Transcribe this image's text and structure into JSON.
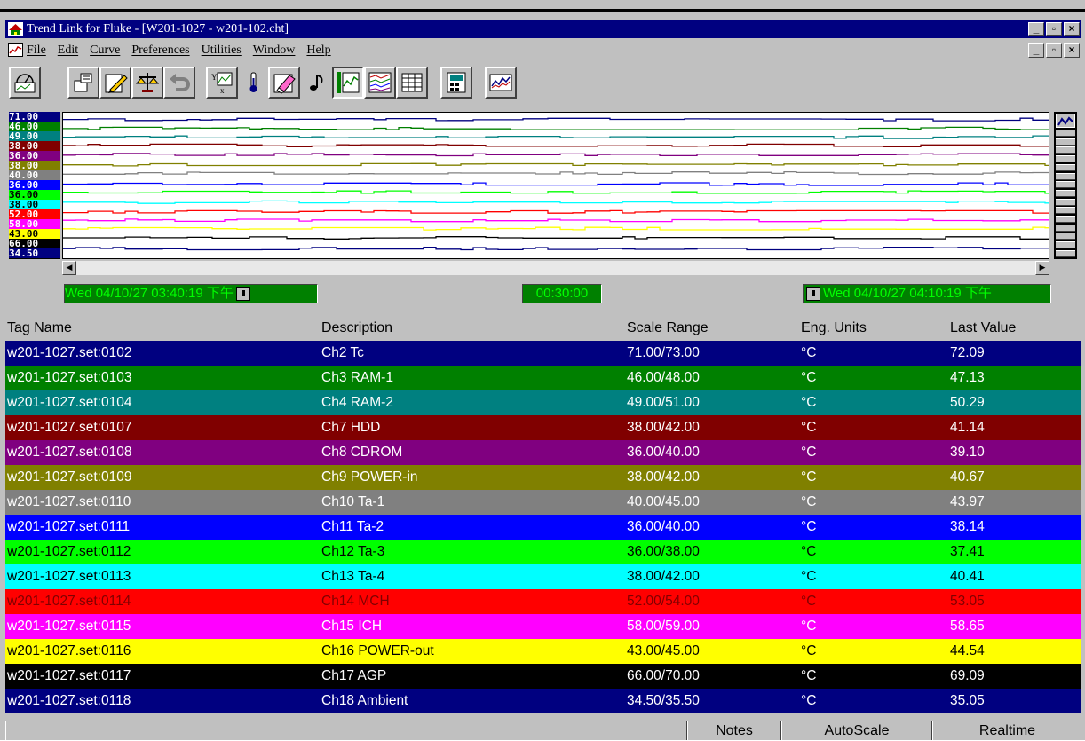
{
  "window": {
    "title": "Trend Link for Fluke - [W201-1027 - w201-102.cht]",
    "controls": [
      "_",
      "▫",
      "×"
    ]
  },
  "menu": [
    "File",
    "Edit",
    "Curve",
    "Preferences",
    "Utilities",
    "Window",
    "Help"
  ],
  "toolbar": {
    "buttons": [
      "gauge-icon",
      "properties-icon",
      "edit-pencil-icon",
      "scale-balance-icon",
      "undo-icon",
      "xy-plot-icon",
      "thermometer-icon",
      "eraser-icon",
      "music-note-icon",
      "trend-view-icon",
      "multi-trend-icon",
      "grid-icon",
      "calculator-icon",
      "chart-icon"
    ],
    "pressed": [
      "trend-view-icon"
    ]
  },
  "chart": {
    "y_labels": [
      "71.00",
      "46.00",
      "49.00",
      "38.00",
      "36.00",
      "38.00",
      "40.00",
      "36.00",
      "36.00",
      "38.00",
      "52.00",
      "58.00",
      "43.00",
      "66.00",
      "34.50"
    ],
    "start_time": "Wed 04/10/27 03:40:19 下午",
    "duration": "00:30:00",
    "end_time": "Wed 04/10/27 04:10:19 下午"
  },
  "table": {
    "headers": [
      "Tag Name",
      "Description",
      "Scale Range",
      "Eng. Units",
      "Last Value"
    ],
    "rows": [
      {
        "tag": "w201-1027.set:0102",
        "desc": "Ch2 Tc",
        "range": "71.00/73.00",
        "unit": "°C",
        "value": "72.09",
        "bg": "#000080",
        "fg": "#ffffff"
      },
      {
        "tag": "w201-1027.set:0103",
        "desc": "Ch3 RAM-1",
        "range": "46.00/48.00",
        "unit": "°C",
        "value": "47.13",
        "bg": "#008000",
        "fg": "#ffffff"
      },
      {
        "tag": "w201-1027.set:0104",
        "desc": "Ch4 RAM-2",
        "range": "49.00/51.00",
        "unit": "°C",
        "value": "50.29",
        "bg": "#008080",
        "fg": "#ffffff"
      },
      {
        "tag": "w201-1027.set:0107",
        "desc": "Ch7 HDD",
        "range": "38.00/42.00",
        "unit": "°C",
        "value": "41.14",
        "bg": "#800000",
        "fg": "#ffffff"
      },
      {
        "tag": "w201-1027.set:0108",
        "desc": "Ch8 CDROM",
        "range": "36.00/40.00",
        "unit": "°C",
        "value": "39.10",
        "bg": "#800080",
        "fg": "#ffffff"
      },
      {
        "tag": "w201-1027.set:0109",
        "desc": "Ch9 POWER-in",
        "range": "38.00/42.00",
        "unit": "°C",
        "value": "40.67",
        "bg": "#808000",
        "fg": "#ffffff"
      },
      {
        "tag": "w201-1027.set:0110",
        "desc": "Ch10 Ta-1",
        "range": "40.00/45.00",
        "unit": "°C",
        "value": "43.97",
        "bg": "#808080",
        "fg": "#ffffff"
      },
      {
        "tag": "w201-1027.set:0111",
        "desc": "Ch11 Ta-2",
        "range": "36.00/40.00",
        "unit": "°C",
        "value": "38.14",
        "bg": "#0000ff",
        "fg": "#ffffff"
      },
      {
        "tag": "w201-1027.set:0112",
        "desc": "Ch12 Ta-3",
        "range": "36.00/38.00",
        "unit": "°C",
        "value": "37.41",
        "bg": "#00ff00",
        "fg": "#000000"
      },
      {
        "tag": "w201-1027.set:0113",
        "desc": "Ch13 Ta-4",
        "range": "38.00/42.00",
        "unit": "°C",
        "value": "40.41",
        "bg": "#00ffff",
        "fg": "#000000"
      },
      {
        "tag": "w201-1027.set:0114",
        "desc": "Ch14 MCH",
        "range": "52.00/54.00",
        "unit": "°C",
        "value": "53.05",
        "bg": "#ff0000",
        "fg": "#800000"
      },
      {
        "tag": "w201-1027.set:0115",
        "desc": "Ch15 ICH",
        "range": "58.00/59.00",
        "unit": "°C",
        "value": "58.65",
        "bg": "#ff00ff",
        "fg": "#ffffff"
      },
      {
        "tag": "w201-1027.set:0116",
        "desc": "Ch16 POWER-out",
        "range": "43.00/45.00",
        "unit": "°C",
        "value": "44.54",
        "bg": "#ffff00",
        "fg": "#000000"
      },
      {
        "tag": "w201-1027.set:0117",
        "desc": "Ch17 AGP",
        "range": "66.00/70.00",
        "unit": "°C",
        "value": "69.09",
        "bg": "#000000",
        "fg": "#ffffff"
      },
      {
        "tag": "w201-1027.set:0118",
        "desc": "Ch18 Ambient",
        "range": "34.50/35.50",
        "unit": "°C",
        "value": "35.05",
        "bg": "#000080",
        "fg": "#ffffff"
      }
    ]
  },
  "statusbar": {
    "notes": "Notes",
    "autoscale": "AutoScale",
    "realtime": "Realtime"
  }
}
